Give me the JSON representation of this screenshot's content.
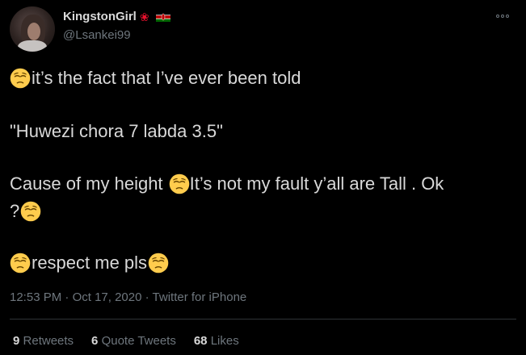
{
  "author": {
    "display_name": "KingstonGirl",
    "handle": "@Lsankei99",
    "icons": [
      "maple-leaf-icon",
      "kenya-flag-icon"
    ]
  },
  "tweet": {
    "line1": "it’s the fact that I’ve ever been told",
    "line2": "\"Huwezi chora 7 labda 3.5\"",
    "line3a": "Cause of my height ",
    "line3b": "It’s not my fault y’all are Tall . Ok",
    "line4": "?",
    "line5": "respect me pls",
    "emoji": "pensive-face-icon"
  },
  "meta": {
    "time": "12:53 PM",
    "date": "Oct 17, 2020",
    "source": "Twitter for iPhone",
    "separator": " · "
  },
  "stats": {
    "retweets_count": "9",
    "retweets_label": "Retweets",
    "quote_count": "6",
    "quote_label": "Quote Tweets",
    "likes_count": "68",
    "likes_label": "Likes"
  },
  "colors": {
    "background": "#000000",
    "text": "#d9d9d9",
    "muted": "#6e767d",
    "divider": "#2f3336",
    "emoji": "#ffcc4d"
  }
}
